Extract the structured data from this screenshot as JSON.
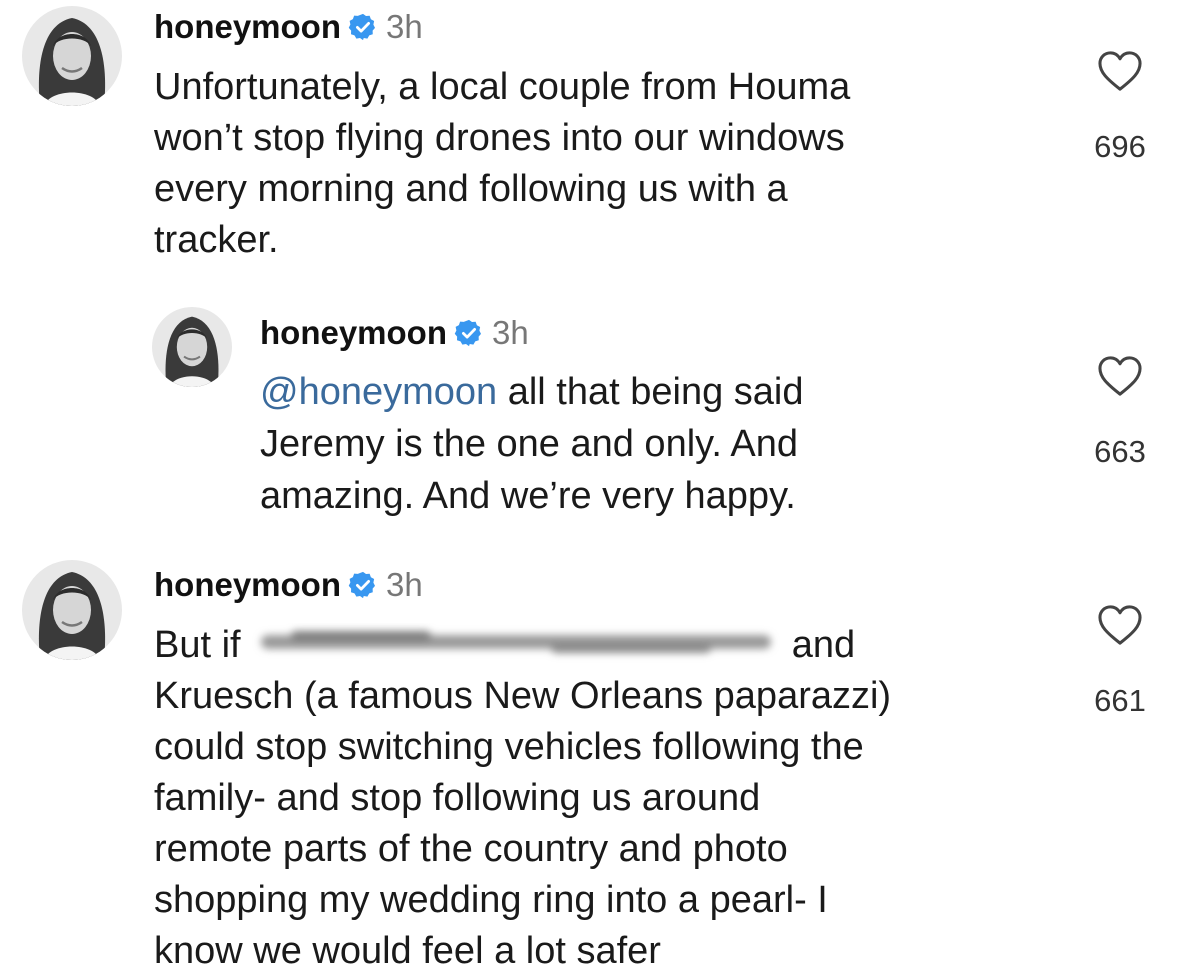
{
  "comments": [
    {
      "username": "honeymoon",
      "time": "3h",
      "lines": [
        "Unfortunately, a local couple from Houma",
        "won’t stop flying drones into our windows",
        "every morning and following us with a",
        "tracker."
      ],
      "likes": "696"
    },
    {
      "username": "honeymoon",
      "time": "3h",
      "mention": "@honeymoon",
      "lines": [
        " all that being said",
        "Jeremy is the one and only. And",
        "amazing. And we’re very happy."
      ],
      "likes": "663"
    },
    {
      "username": "honeymoon",
      "time": "3h",
      "first_line_before": "But if ",
      "first_line_after": " and",
      "lines": [
        "Kruesch (a famous New Orleans paparazzi)",
        "could stop switching vehicles following the",
        "family- and  stop following us around",
        "remote parts of the country and photo",
        "shopping my wedding ring into a pearl- I",
        "know we would feel a lot safer"
      ],
      "likes": "661"
    }
  ],
  "icons": {
    "verified": "verified-badge-icon",
    "like": "heart-icon"
  },
  "colors": {
    "verified": "#3897f0",
    "mention": "#3a6a9c",
    "time": "#777777"
  }
}
